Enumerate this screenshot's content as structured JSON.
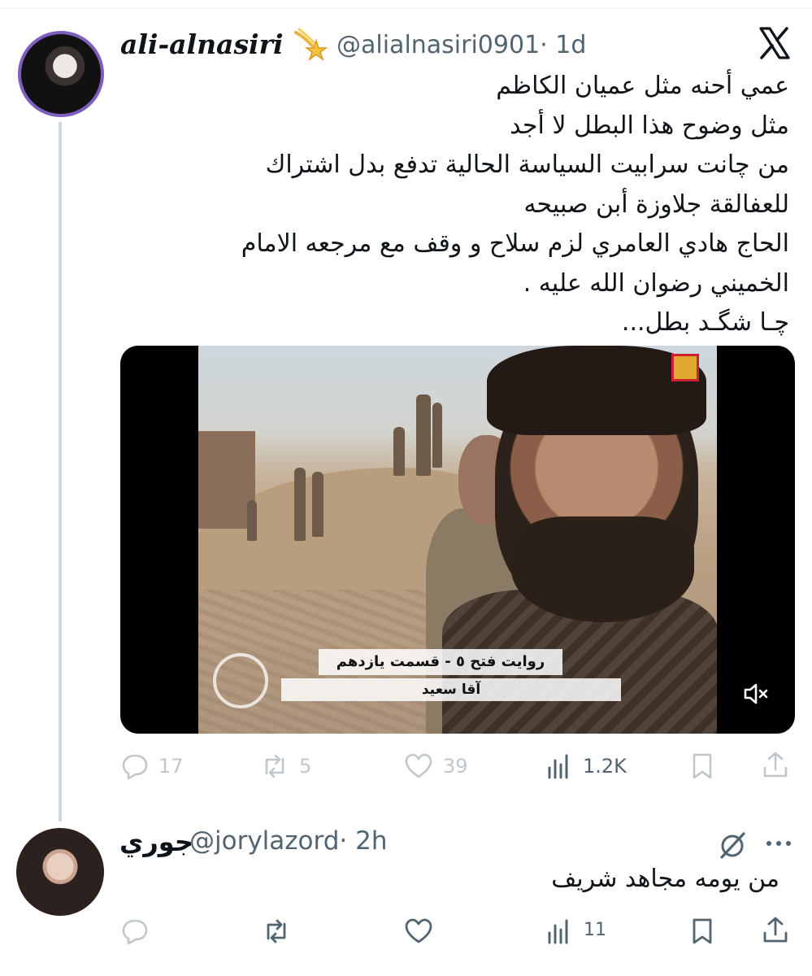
{
  "tweet": {
    "author_name": "ali-alnasiri",
    "author_handle": "@alialnasiri0901",
    "timestamp": "· 1d",
    "badge_icon": "shooting-star-emoji",
    "lines": [
      "عمي أحنه مثل عميان الكاظم",
      "مثل وضوح هذا البطل لا أجد",
      "من چانت سرابيت السياسة الحالية  تدفع بدل اشتراك",
      "للعفالقة جلاوزة أبن صبيحه",
      "الحاج هادي العامري لزم سلاح و وقف مع مرجعه الامام",
      "الخميني رضوان الله عليه .",
      "چـا شگـد بطل..."
    ],
    "video": {
      "subtitle_line1": "روايت فتح ٥ - قسمت يازدهم",
      "subtitle_line2": "آقا سعيد",
      "mute_icon": "speaker-muted-icon"
    },
    "actions": {
      "replies": "17",
      "reposts": "5",
      "likes": "39",
      "views": "1.2K"
    }
  },
  "reply": {
    "author_name": "جوري",
    "author_handle": "@jorylazord",
    "timestamp": "· 2h",
    "text": "من يومه مجاهد شريف",
    "actions": {
      "replies": "",
      "reposts": "",
      "likes": "",
      "views": "11"
    }
  },
  "colors": {
    "text": "#0f1419",
    "secondary": "#536471",
    "faded": "#c0c7cc",
    "thread_line": "#cfd9de"
  }
}
